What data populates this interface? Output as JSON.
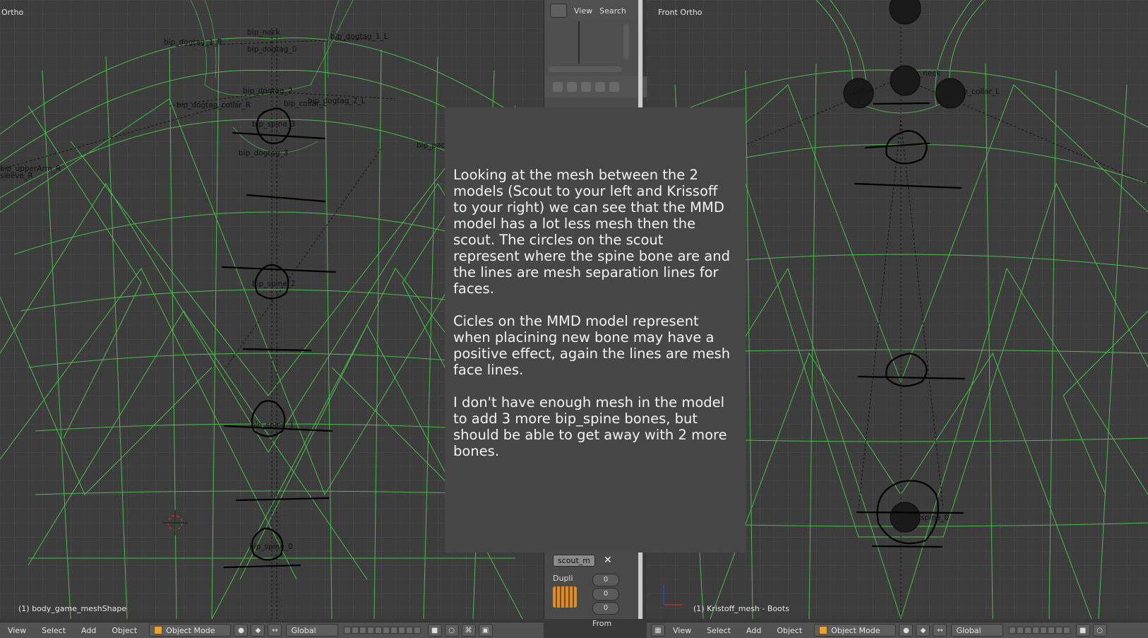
{
  "left_viewport": {
    "title": "Ortho",
    "object_info": "(1) body_game_meshShape",
    "bones": [
      "bip_neck",
      "bip_dogtag_1_L",
      "bip_dogtag_1_R",
      "bip_dogtag_0",
      "bip_dogtag_2",
      "bip_dogtag_2_L",
      "bip_dogtag_collar_R",
      "bip_collar_L",
      "bip_spine_3",
      "bip_dogtag_3",
      "bip_upperArm_R",
      "sleeve_R",
      "bip_pacl",
      "bip_spine_2",
      "bip_spine_1",
      "bip_spine_0"
    ]
  },
  "right_viewport": {
    "title": "Front Ortho",
    "object_info": "(1) Kristoff_mesh - Boots",
    "bones": [
      "_neck",
      "_collar",
      "p_collar_L",
      "spine_0"
    ]
  },
  "middle_panel": {
    "header_view": "View",
    "header_search": "Search",
    "object_name": "scout_m",
    "close_symbol": "✕",
    "dupli_label": "Dupli",
    "dupli_values": [
      "0",
      "0",
      "0"
    ],
    "from_label": "From"
  },
  "overlay": {
    "paragraphs": [
      "Looking at the mesh between the 2 models (Scout to your left and Krissoff to your right) we can see that the MMD model has a lot less mesh then the scout.  The circles on the scout represent where the spine bone are and the lines are mesh separation lines for faces.",
      "Cicles on the MMD model represent when placining new bone may have a positive effect, again the lines are mesh face lines.",
      "I don't have enough mesh in the model to add 3 more bip_spine bones, but should be able to get away with 2 more bones."
    ]
  },
  "bottom_bar_left": {
    "menu": [
      "View",
      "Select",
      "Add",
      "Object"
    ],
    "mode": "Object Mode",
    "orientation": "Global"
  },
  "bottom_bar_right": {
    "menu": [
      "View",
      "Select",
      "Add",
      "Object"
    ],
    "mode": "Object Mode",
    "orientation": "Global"
  },
  "colors": {
    "wireframe": "#4fd14f",
    "background": "#3d3d3d",
    "overlay_bg": "#474747",
    "object_cube": "#e6a13a"
  }
}
